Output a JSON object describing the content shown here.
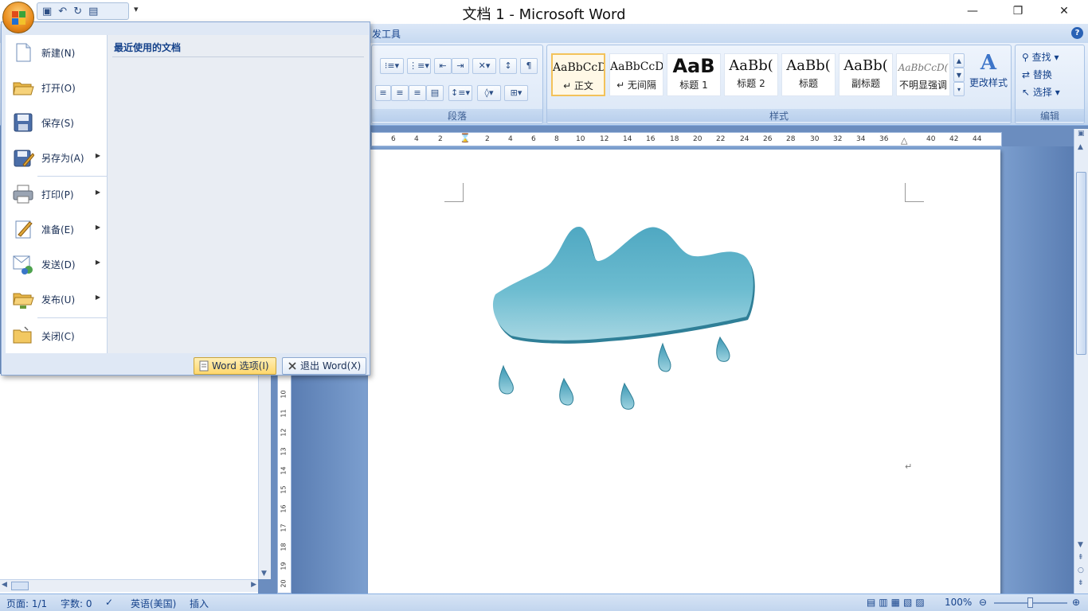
{
  "window": {
    "title": "文档 1 - Microsoft Word",
    "min_symbol": "—",
    "max_symbol": "❐",
    "close_symbol": "✕"
  },
  "quick_access": {
    "more_symbol": "▾"
  },
  "ribbon": {
    "tab_partial": "发工具",
    "help_symbol": "?",
    "paragraph_label": "段落",
    "styles_label": "样式",
    "editing_label": "编辑",
    "change_styles_label": "更改样式",
    "styles": [
      {
        "sample": "AaBbCcD",
        "name": "↵ 正文"
      },
      {
        "sample": "AaBbCcD",
        "name": "↵ 无间隔"
      },
      {
        "sample": "AaB",
        "name": "标题 1"
      },
      {
        "sample": "AaBb(",
        "name": "标题 2"
      },
      {
        "sample": "AaBb(",
        "name": "标题"
      },
      {
        "sample": "AaBb(",
        "name": "副标题"
      },
      {
        "sample": "AaBbCcD(",
        "name": "不明显强调"
      }
    ],
    "editing": {
      "find": "查找 ▾",
      "replace": "替换",
      "select": "选择 ▾"
    }
  },
  "ruler": {
    "h_ticks": [
      "6",
      "4",
      "2",
      "2",
      "4",
      "6",
      "8",
      "10",
      "12",
      "14",
      "16",
      "18",
      "20",
      "22",
      "24",
      "26",
      "28",
      "30",
      "32",
      "34",
      "36",
      "40",
      "42",
      "44"
    ],
    "v_ticks": [
      "10",
      "11",
      "12",
      "13",
      "14",
      "15",
      "16",
      "17",
      "18",
      "19",
      "20"
    ]
  },
  "document": {
    "paragraph_mark": "↵"
  },
  "office_menu": {
    "recent_title": "最近使用的文档",
    "items": [
      {
        "label": "新建(N)",
        "icon": "new-document-icon"
      },
      {
        "label": "打开(O)",
        "icon": "open-folder-icon"
      },
      {
        "label": "保存(S)",
        "icon": "save-disk-icon"
      },
      {
        "label": "另存为(A)",
        "icon": "save-as-icon"
      },
      {
        "label": "打印(P)",
        "icon": "printer-icon"
      },
      {
        "label": "准备(E)",
        "icon": "prepare-icon"
      },
      {
        "label": "发送(D)",
        "icon": "send-icon"
      },
      {
        "label": "发布(U)",
        "icon": "publish-icon"
      },
      {
        "label": "关闭(C)",
        "icon": "close-folder-icon"
      }
    ],
    "word_options": "Word 选项(I)",
    "exit_word": "退出 Word(X)"
  },
  "status": {
    "page": "页面: 1/1",
    "words": "字数: 0",
    "language": "英语(美国)",
    "mode": "插入",
    "zoom": "100%"
  },
  "colors": {
    "cloud": "#5fb3c9",
    "accent": "#15428b"
  }
}
